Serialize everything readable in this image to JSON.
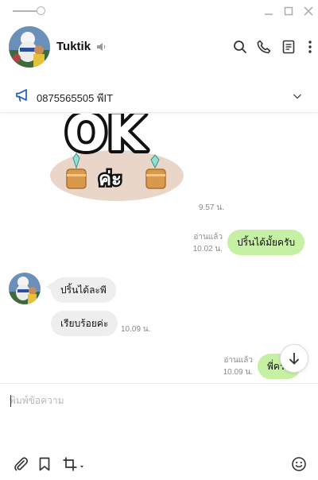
{
  "header": {
    "contact_name": "Tuktik"
  },
  "announcement": {
    "text": "0875565505 พีIT"
  },
  "messages": {
    "sticker_time": "9.57 น.",
    "m1_read": "อ่านแล้ว",
    "m1_time": "10.02 น.",
    "m1_text": "ปริ้นได้มั้ยครับ",
    "m2_text": "ปริ้นได้ละพี",
    "m3_text": "เรียบร้อยค่ะ",
    "m3_time": "10.09 น.",
    "m4_read": "อ่านแล้ว",
    "m4_time": "10.09 น.",
    "m4_text": "พี่ครับ"
  },
  "sticker": {
    "text_top": "OK",
    "text_bottom": "ค่ะ"
  },
  "input": {
    "placeholder": "พิมพ์ข้อความ",
    "value": ""
  },
  "colors": {
    "my_bubble": "#c6f1a4",
    "their_bubble": "#eeeeee",
    "accent_announce": "#1e5fb4"
  },
  "icons": [
    "slider-icon",
    "minimize-icon",
    "maximize-icon",
    "close-icon",
    "speaker-icon",
    "search-icon",
    "phone-icon",
    "notes-icon",
    "more-icon",
    "megaphone-icon",
    "chevron-down-icon",
    "arrow-down-icon",
    "paperclip-icon",
    "bookmark-icon",
    "crop-icon",
    "emoji-icon"
  ]
}
